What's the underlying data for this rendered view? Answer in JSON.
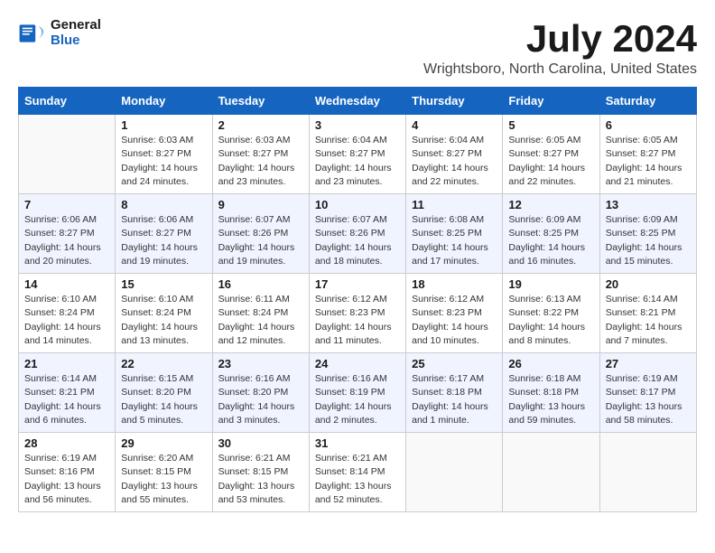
{
  "header": {
    "logo_line1": "General",
    "logo_line2": "Blue",
    "month": "July 2024",
    "location": "Wrightsboro, North Carolina, United States"
  },
  "days_of_week": [
    "Sunday",
    "Monday",
    "Tuesday",
    "Wednesday",
    "Thursday",
    "Friday",
    "Saturday"
  ],
  "weeks": [
    [
      {
        "day": "",
        "info": ""
      },
      {
        "day": "1",
        "info": "Sunrise: 6:03 AM\nSunset: 8:27 PM\nDaylight: 14 hours\nand 24 minutes."
      },
      {
        "day": "2",
        "info": "Sunrise: 6:03 AM\nSunset: 8:27 PM\nDaylight: 14 hours\nand 23 minutes."
      },
      {
        "day": "3",
        "info": "Sunrise: 6:04 AM\nSunset: 8:27 PM\nDaylight: 14 hours\nand 23 minutes."
      },
      {
        "day": "4",
        "info": "Sunrise: 6:04 AM\nSunset: 8:27 PM\nDaylight: 14 hours\nand 22 minutes."
      },
      {
        "day": "5",
        "info": "Sunrise: 6:05 AM\nSunset: 8:27 PM\nDaylight: 14 hours\nand 22 minutes."
      },
      {
        "day": "6",
        "info": "Sunrise: 6:05 AM\nSunset: 8:27 PM\nDaylight: 14 hours\nand 21 minutes."
      }
    ],
    [
      {
        "day": "7",
        "info": "Sunrise: 6:06 AM\nSunset: 8:27 PM\nDaylight: 14 hours\nand 20 minutes."
      },
      {
        "day": "8",
        "info": "Sunrise: 6:06 AM\nSunset: 8:27 PM\nDaylight: 14 hours\nand 19 minutes."
      },
      {
        "day": "9",
        "info": "Sunrise: 6:07 AM\nSunset: 8:26 PM\nDaylight: 14 hours\nand 19 minutes."
      },
      {
        "day": "10",
        "info": "Sunrise: 6:07 AM\nSunset: 8:26 PM\nDaylight: 14 hours\nand 18 minutes."
      },
      {
        "day": "11",
        "info": "Sunrise: 6:08 AM\nSunset: 8:25 PM\nDaylight: 14 hours\nand 17 minutes."
      },
      {
        "day": "12",
        "info": "Sunrise: 6:09 AM\nSunset: 8:25 PM\nDaylight: 14 hours\nand 16 minutes."
      },
      {
        "day": "13",
        "info": "Sunrise: 6:09 AM\nSunset: 8:25 PM\nDaylight: 14 hours\nand 15 minutes."
      }
    ],
    [
      {
        "day": "14",
        "info": "Sunrise: 6:10 AM\nSunset: 8:24 PM\nDaylight: 14 hours\nand 14 minutes."
      },
      {
        "day": "15",
        "info": "Sunrise: 6:10 AM\nSunset: 8:24 PM\nDaylight: 14 hours\nand 13 minutes."
      },
      {
        "day": "16",
        "info": "Sunrise: 6:11 AM\nSunset: 8:24 PM\nDaylight: 14 hours\nand 12 minutes."
      },
      {
        "day": "17",
        "info": "Sunrise: 6:12 AM\nSunset: 8:23 PM\nDaylight: 14 hours\nand 11 minutes."
      },
      {
        "day": "18",
        "info": "Sunrise: 6:12 AM\nSunset: 8:23 PM\nDaylight: 14 hours\nand 10 minutes."
      },
      {
        "day": "19",
        "info": "Sunrise: 6:13 AM\nSunset: 8:22 PM\nDaylight: 14 hours\nand 8 minutes."
      },
      {
        "day": "20",
        "info": "Sunrise: 6:14 AM\nSunset: 8:21 PM\nDaylight: 14 hours\nand 7 minutes."
      }
    ],
    [
      {
        "day": "21",
        "info": "Sunrise: 6:14 AM\nSunset: 8:21 PM\nDaylight: 14 hours\nand 6 minutes."
      },
      {
        "day": "22",
        "info": "Sunrise: 6:15 AM\nSunset: 8:20 PM\nDaylight: 14 hours\nand 5 minutes."
      },
      {
        "day": "23",
        "info": "Sunrise: 6:16 AM\nSunset: 8:20 PM\nDaylight: 14 hours\nand 3 minutes."
      },
      {
        "day": "24",
        "info": "Sunrise: 6:16 AM\nSunset: 8:19 PM\nDaylight: 14 hours\nand 2 minutes."
      },
      {
        "day": "25",
        "info": "Sunrise: 6:17 AM\nSunset: 8:18 PM\nDaylight: 14 hours\nand 1 minute."
      },
      {
        "day": "26",
        "info": "Sunrise: 6:18 AM\nSunset: 8:18 PM\nDaylight: 13 hours\nand 59 minutes."
      },
      {
        "day": "27",
        "info": "Sunrise: 6:19 AM\nSunset: 8:17 PM\nDaylight: 13 hours\nand 58 minutes."
      }
    ],
    [
      {
        "day": "28",
        "info": "Sunrise: 6:19 AM\nSunset: 8:16 PM\nDaylight: 13 hours\nand 56 minutes."
      },
      {
        "day": "29",
        "info": "Sunrise: 6:20 AM\nSunset: 8:15 PM\nDaylight: 13 hours\nand 55 minutes."
      },
      {
        "day": "30",
        "info": "Sunrise: 6:21 AM\nSunset: 8:15 PM\nDaylight: 13 hours\nand 53 minutes."
      },
      {
        "day": "31",
        "info": "Sunrise: 6:21 AM\nSunset: 8:14 PM\nDaylight: 13 hours\nand 52 minutes."
      },
      {
        "day": "",
        "info": ""
      },
      {
        "day": "",
        "info": ""
      },
      {
        "day": "",
        "info": ""
      }
    ]
  ]
}
